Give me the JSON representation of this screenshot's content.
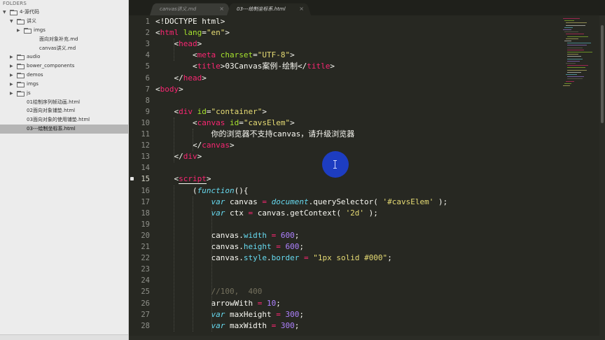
{
  "sidebar": {
    "header": "FOLDERS",
    "items": [
      {
        "label": "4-源代码",
        "arrow": "▼",
        "folder": true,
        "selected": false
      },
      {
        "label": "讲义",
        "arrow": "▼",
        "folder": true,
        "selected": false
      },
      {
        "label": "imgs",
        "arrow": "▶",
        "folder": true,
        "selected": false
      },
      {
        "label": "面向对象补充.md",
        "arrow": "",
        "folder": false,
        "selected": false
      },
      {
        "label": "canvas讲义.md",
        "arrow": "",
        "folder": false,
        "selected": false
      },
      {
        "label": "audio",
        "arrow": "▶",
        "folder": true,
        "selected": false
      },
      {
        "label": "bower_components",
        "arrow": "▶",
        "folder": true,
        "selected": false
      },
      {
        "label": "demos",
        "arrow": "▶",
        "folder": true,
        "selected": false
      },
      {
        "label": "imgs",
        "arrow": "▶",
        "folder": true,
        "selected": false
      },
      {
        "label": "js",
        "arrow": "▶",
        "folder": true,
        "selected": false
      },
      {
        "label": "01绘制序列帧动画.html",
        "arrow": "",
        "folder": false,
        "selected": false
      },
      {
        "label": "02面向对象铺垫.html",
        "arrow": "",
        "folder": false,
        "selected": false
      },
      {
        "label": "03面向对象的使用铺垫.html",
        "arrow": "",
        "folder": false,
        "selected": false
      },
      {
        "label": "03---绘制坐标系.html",
        "arrow": "",
        "folder": false,
        "selected": true
      }
    ]
  },
  "tabs": [
    {
      "label": "canvas讲义.md",
      "close": "×",
      "active": false
    },
    {
      "label": "03---绘制坐标系.html",
      "close": "×",
      "active": true
    }
  ],
  "editor": {
    "current_line": "15",
    "lines": [
      {
        "n": "1",
        "tokens": [
          [
            "t-plain",
            "<!DOCTYPE html>"
          ]
        ]
      },
      {
        "n": "2",
        "tokens": [
          [
            "t-plain",
            "<"
          ],
          [
            "t-tag",
            "html"
          ],
          [
            "t-attr",
            " lang"
          ],
          [
            "t-plain",
            "="
          ],
          [
            "t-str",
            "\"en\""
          ],
          [
            "t-plain",
            ">"
          ]
        ]
      },
      {
        "n": "3",
        "tokens": [
          [
            "t-plain",
            "    <"
          ],
          [
            "t-tag",
            "head"
          ],
          [
            "t-plain",
            ">"
          ]
        ]
      },
      {
        "n": "4",
        "tokens": [
          [
            "t-plain",
            "        <"
          ],
          [
            "t-tag",
            "meta"
          ],
          [
            "t-attr",
            " charset"
          ],
          [
            "t-plain",
            "="
          ],
          [
            "t-str",
            "\"UTF-8\""
          ],
          [
            "t-plain",
            ">"
          ]
        ]
      },
      {
        "n": "5",
        "tokens": [
          [
            "t-plain",
            "        <"
          ],
          [
            "t-tag",
            "title"
          ],
          [
            "t-plain",
            ">03Canvas案例-绘制</"
          ],
          [
            "t-tag",
            "title"
          ],
          [
            "t-plain",
            ">"
          ]
        ]
      },
      {
        "n": "6",
        "tokens": [
          [
            "t-plain",
            "    </"
          ],
          [
            "t-tag",
            "head"
          ],
          [
            "t-plain",
            ">"
          ]
        ]
      },
      {
        "n": "7",
        "tokens": [
          [
            "t-plain",
            "<"
          ],
          [
            "t-tag",
            "body"
          ],
          [
            "t-plain",
            ">"
          ]
        ]
      },
      {
        "n": "8",
        "tokens": []
      },
      {
        "n": "9",
        "tokens": [
          [
            "t-plain",
            "    <"
          ],
          [
            "t-tag",
            "div"
          ],
          [
            "t-attr",
            " id"
          ],
          [
            "t-plain",
            "="
          ],
          [
            "t-str",
            "\"container\""
          ],
          [
            "t-plain",
            ">"
          ]
        ]
      },
      {
        "n": "10",
        "tokens": [
          [
            "t-plain",
            "        <"
          ],
          [
            "t-tag",
            "canvas"
          ],
          [
            "t-attr",
            " id"
          ],
          [
            "t-plain",
            "="
          ],
          [
            "t-str",
            "\"cavsElem\""
          ],
          [
            "t-plain",
            ">"
          ]
        ]
      },
      {
        "n": "11",
        "tokens": [
          [
            "t-plain",
            "            你的浏览器不支持canvas，请升级浏览器"
          ]
        ]
      },
      {
        "n": "12",
        "tokens": [
          [
            "t-plain",
            "        </"
          ],
          [
            "t-tag",
            "canvas"
          ],
          [
            "t-plain",
            ">"
          ]
        ]
      },
      {
        "n": "13",
        "tokens": [
          [
            "t-plain",
            "    </"
          ],
          [
            "t-tag",
            "div"
          ],
          [
            "t-plain",
            ">"
          ]
        ]
      },
      {
        "n": "14",
        "tokens": []
      },
      {
        "n": "15",
        "tokens": [
          [
            "t-plain",
            "    <"
          ],
          [
            "t-tag t-script-hl",
            "script"
          ],
          [
            "t-plain",
            ">"
          ]
        ]
      },
      {
        "n": "16",
        "tokens": [
          [
            "t-plain",
            "        ("
          ],
          [
            "t-kw",
            "function"
          ],
          [
            "t-plain",
            "(){"
          ]
        ]
      },
      {
        "n": "17",
        "tokens": [
          [
            "t-plain",
            "            "
          ],
          [
            "t-kw",
            "var"
          ],
          [
            "t-plain",
            " canvas "
          ],
          [
            "t-op",
            "="
          ],
          [
            "t-plain",
            " "
          ],
          [
            "t-kw",
            "document"
          ],
          [
            "t-plain",
            ".querySelector( "
          ],
          [
            "t-str",
            "'#cavsElem'"
          ],
          [
            "t-plain",
            " );"
          ]
        ]
      },
      {
        "n": "18",
        "tokens": [
          [
            "t-plain",
            "            "
          ],
          [
            "t-kw",
            "var"
          ],
          [
            "t-plain",
            " ctx "
          ],
          [
            "t-op",
            "="
          ],
          [
            "t-plain",
            " canvas.getContext( "
          ],
          [
            "t-str",
            "'2d'"
          ],
          [
            "t-plain",
            " );"
          ]
        ]
      },
      {
        "n": "19",
        "tokens": []
      },
      {
        "n": "20",
        "tokens": [
          [
            "t-plain",
            "            canvas."
          ],
          [
            "t-prop",
            "width"
          ],
          [
            "t-plain",
            " "
          ],
          [
            "t-op",
            "="
          ],
          [
            "t-plain",
            " "
          ],
          [
            "t-num",
            "600"
          ],
          [
            "t-plain",
            ";"
          ]
        ]
      },
      {
        "n": "21",
        "tokens": [
          [
            "t-plain",
            "            canvas."
          ],
          [
            "t-prop",
            "height"
          ],
          [
            "t-plain",
            " "
          ],
          [
            "t-op",
            "="
          ],
          [
            "t-plain",
            " "
          ],
          [
            "t-num",
            "600"
          ],
          [
            "t-plain",
            ";"
          ]
        ]
      },
      {
        "n": "22",
        "tokens": [
          [
            "t-plain",
            "            canvas."
          ],
          [
            "t-prop",
            "style"
          ],
          [
            "t-plain",
            "."
          ],
          [
            "t-prop",
            "border"
          ],
          [
            "t-plain",
            " "
          ],
          [
            "t-op",
            "="
          ],
          [
            "t-plain",
            " "
          ],
          [
            "t-str",
            "\"1px solid #000\""
          ],
          [
            "t-plain",
            ";"
          ]
        ]
      },
      {
        "n": "23",
        "tokens": []
      },
      {
        "n": "24",
        "tokens": []
      },
      {
        "n": "25",
        "tokens": [
          [
            "t-plain",
            "            "
          ],
          [
            "t-cmt",
            "//100,  400"
          ]
        ]
      },
      {
        "n": "26",
        "tokens": [
          [
            "t-plain",
            "            arrowWith "
          ],
          [
            "t-op",
            "="
          ],
          [
            "t-plain",
            " "
          ],
          [
            "t-num",
            "10"
          ],
          [
            "t-plain",
            ";"
          ]
        ]
      },
      {
        "n": "27",
        "tokens": [
          [
            "t-plain",
            "            "
          ],
          [
            "t-kw",
            "var"
          ],
          [
            "t-plain",
            " maxHeight "
          ],
          [
            "t-op",
            "="
          ],
          [
            "t-plain",
            " "
          ],
          [
            "t-num",
            "300"
          ],
          [
            "t-plain",
            ";"
          ]
        ]
      },
      {
        "n": "28",
        "tokens": [
          [
            "t-plain",
            "            "
          ],
          [
            "t-kw",
            "var"
          ],
          [
            "t-plain",
            " maxWidth "
          ],
          [
            "t-op",
            "="
          ],
          [
            "t-plain",
            " "
          ],
          [
            "t-num",
            "300"
          ],
          [
            "t-plain",
            ";"
          ]
        ]
      }
    ]
  },
  "colors": {
    "editor_bg": "#272822",
    "tag": "#f92672",
    "attr": "#a6e22e",
    "string": "#e6db74",
    "keyword": "#66d9ef",
    "number": "#ae81ff",
    "comment": "#75715e",
    "cursor_highlight": "#1c3fcf"
  }
}
